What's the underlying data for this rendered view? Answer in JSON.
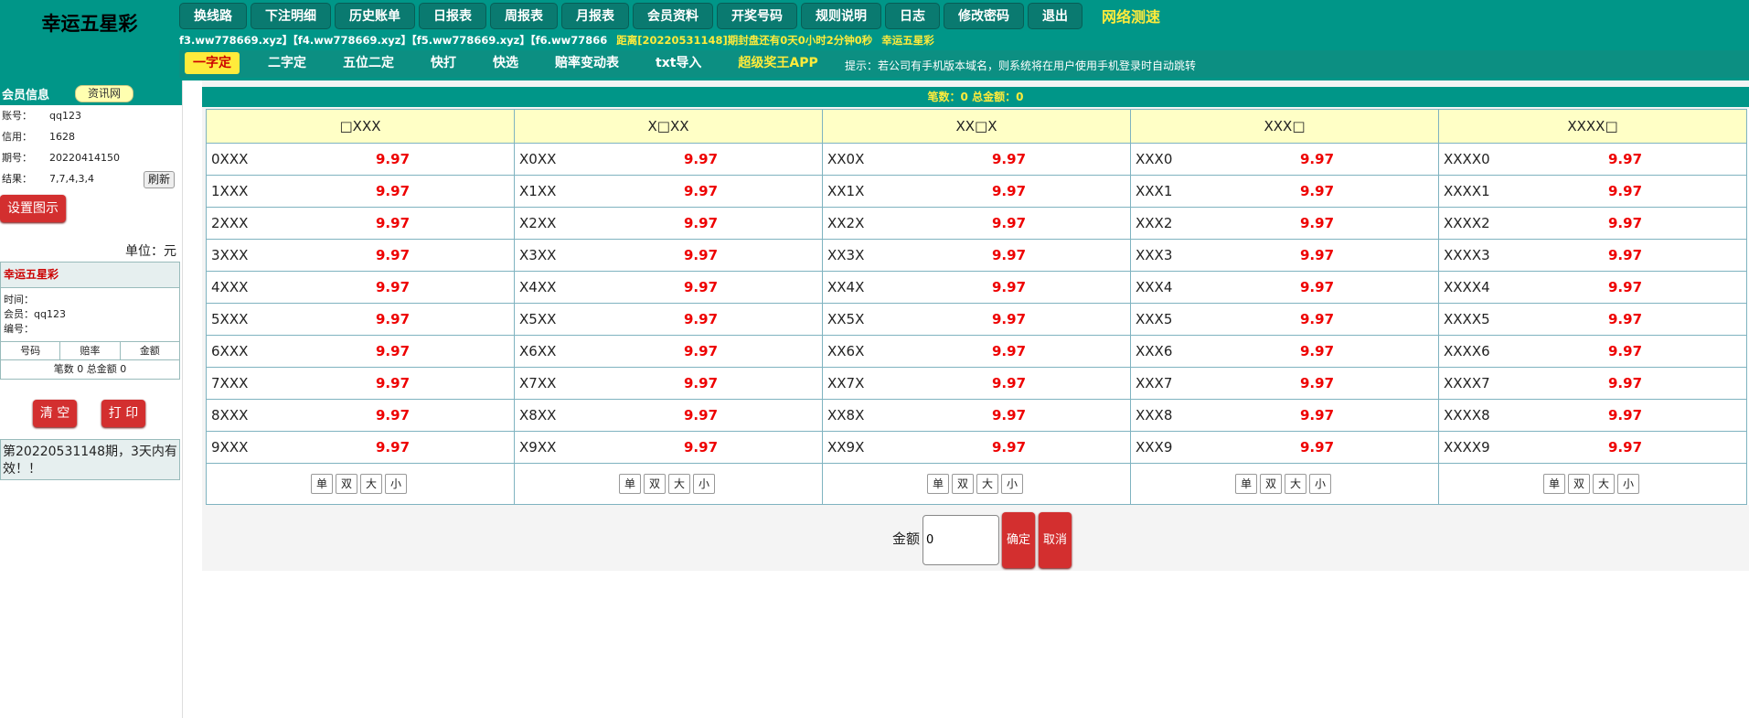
{
  "app": {
    "title": "幸运五星彩",
    "speed_test": "网络测速"
  },
  "top_nav": [
    "换线路",
    "下注明细",
    "历史账单",
    "日报表",
    "周报表",
    "月报表",
    "会员资料",
    "开奖号码",
    "规则说明",
    "日志",
    "修改密码",
    "退出"
  ],
  "info_line": {
    "domains": "f3.ww778669.xyz】【f4.ww778669.xyz】【f5.ww778669.xyz】【f6.ww77866",
    "countdown": "距离[20220531148]期封盘还有0天0小时2分钟0秒",
    "game": "幸运五星彩"
  },
  "sub_nav": [
    "一字定",
    "二字定",
    "五位二定",
    "快打",
    "快选",
    "赔率变动表",
    "txt导入",
    "超级奖王APP"
  ],
  "tip": "提示：若公司有手机版本域名，则系统将在用户使用手机登录时自动跳转",
  "member": {
    "title": "会员信息",
    "zixun": "资讯网",
    "account_label": "账号：",
    "account": "qq123",
    "credit_label": "信用：",
    "credit": "1628",
    "period_label": "期号：",
    "period": "20220414150",
    "result_label": "结果：",
    "result": "7,7,4,3,4",
    "refresh": "刷新",
    "settings": "设置图示",
    "unit": "单位：元"
  },
  "slip": {
    "title": "幸运五星彩",
    "time": "时间：",
    "member": "会员：qq123",
    "number": "编号：",
    "col_number": "号码",
    "col_odds": "赔率",
    "col_amount": "金额",
    "summary": "笔数 0 总金额 0",
    "clear": "清 空",
    "print": "打 印",
    "validity": "第20220531148期，3天内有效！！"
  },
  "count_bar": "笔数：0 总金额：0",
  "columns": [
    {
      "head": "□XXX",
      "rows": [
        "0XXX",
        "1XXX",
        "2XXX",
        "3XXX",
        "4XXX",
        "5XXX",
        "6XXX",
        "7XXX",
        "8XXX",
        "9XXX"
      ]
    },
    {
      "head": "X□XX",
      "rows": [
        "X0XX",
        "X1XX",
        "X2XX",
        "X3XX",
        "X4XX",
        "X5XX",
        "X6XX",
        "X7XX",
        "X8XX",
        "X9XX"
      ]
    },
    {
      "head": "XX□X",
      "rows": [
        "XX0X",
        "XX1X",
        "XX2X",
        "XX3X",
        "XX4X",
        "XX5X",
        "XX6X",
        "XX7X",
        "XX8X",
        "XX9X"
      ]
    },
    {
      "head": "XXX□",
      "rows": [
        "XXX0",
        "XXX1",
        "XXX2",
        "XXX3",
        "XXX4",
        "XXX5",
        "XXX6",
        "XXX7",
        "XXX8",
        "XXX9"
      ]
    },
    {
      "head": "XXXX□",
      "rows": [
        "XXXX0",
        "XXXX1",
        "XXXX2",
        "XXXX3",
        "XXXX4",
        "XXXX5",
        "XXXX6",
        "XXXX7",
        "XXXX8",
        "XXXX9"
      ]
    }
  ],
  "odds": "9.97",
  "quick_buttons": [
    "单",
    "双",
    "大",
    "小"
  ],
  "amount": {
    "label": "金额",
    "value": "0",
    "confirm": "确定",
    "cancel": "取消"
  },
  "colors": {
    "teal": "#009688",
    "yellow": "#ffeb3b",
    "red": "#d32f2f",
    "odds": "#e00000",
    "header_cell": "#ffffc6"
  }
}
